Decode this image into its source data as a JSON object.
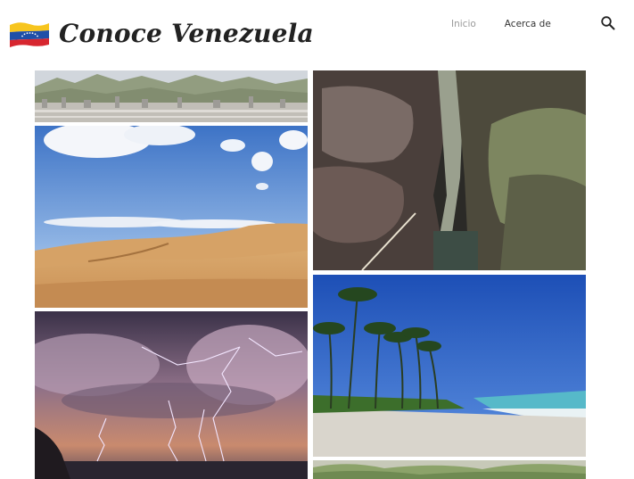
{
  "site": {
    "title": "Conoce Venezuela",
    "logo_icon": "venezuela-flag-icon"
  },
  "nav": {
    "items": [
      {
        "label": "Inicio",
        "active": true
      },
      {
        "label": "Acerca de",
        "active": false
      }
    ],
    "search_icon": "search-icon"
  },
  "gallery": {
    "tiles": [
      {
        "subject": "caracas-city-mountains"
      },
      {
        "subject": "sand-dunes"
      },
      {
        "subject": "rock-canyon"
      },
      {
        "subject": "lightning-storm"
      },
      {
        "subject": "palm-beach"
      },
      {
        "subject": "green-foliage"
      }
    ]
  },
  "colors": {
    "nav_active": "#9a9a9a",
    "nav_default": "#333333",
    "title": "#222222"
  }
}
